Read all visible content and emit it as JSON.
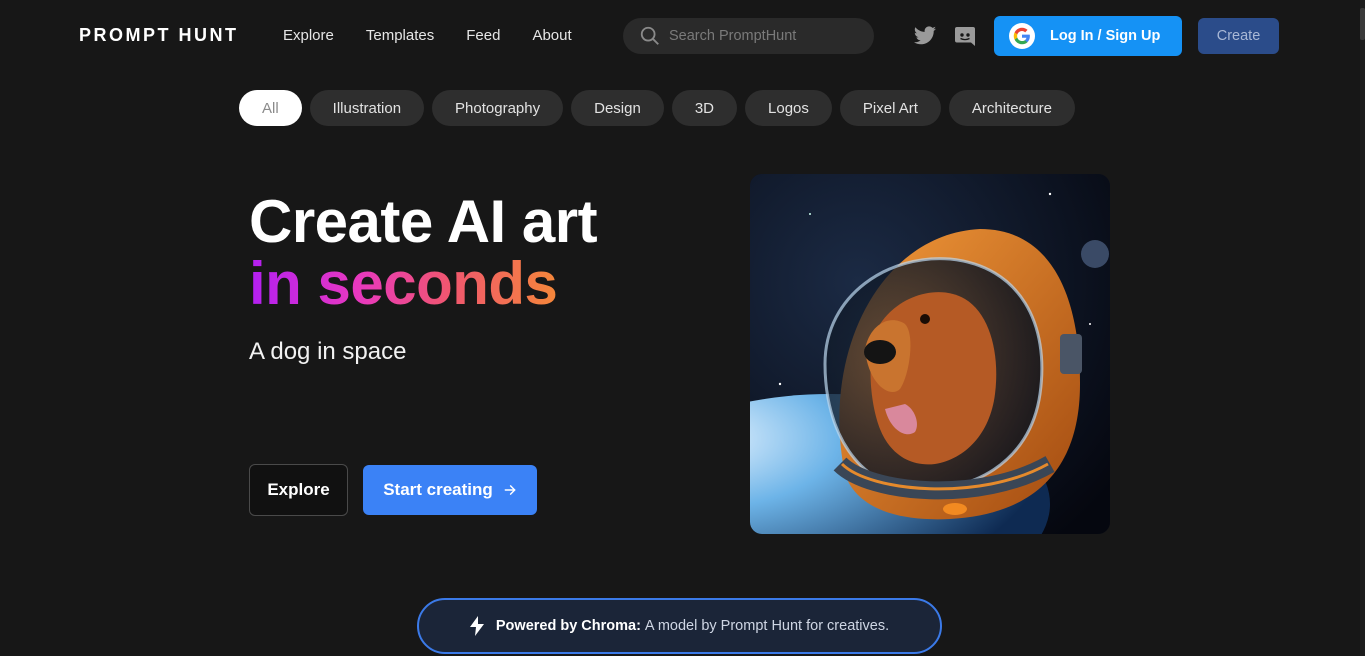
{
  "brand": {
    "logo": "PROMPT HUNT"
  },
  "nav": [
    {
      "label": "Explore",
      "name": "nav-explore"
    },
    {
      "label": "Templates",
      "name": "nav-templates"
    },
    {
      "label": "Feed",
      "name": "nav-feed"
    },
    {
      "label": "About",
      "name": "nav-about"
    }
  ],
  "search": {
    "placeholder": "Search PromptHunt",
    "value": ""
  },
  "header": {
    "login_label": "Log In / Sign Up",
    "create_label": "Create"
  },
  "categories": [
    {
      "label": "All",
      "active": true
    },
    {
      "label": "Illustration",
      "active": false
    },
    {
      "label": "Photography",
      "active": false
    },
    {
      "label": "Design",
      "active": false
    },
    {
      "label": "3D",
      "active": false
    },
    {
      "label": "Logos",
      "active": false
    },
    {
      "label": "Pixel Art",
      "active": false
    },
    {
      "label": "Architecture",
      "active": false
    }
  ],
  "hero": {
    "title_line1": "Create AI art",
    "title_line2": "in seconds",
    "subtitle": "A dog in space",
    "explore_label": "Explore",
    "start_label": "Start creating"
  },
  "powered": {
    "bold": "Powered by Chroma:",
    "text": "A model by Prompt Hunt for creatives."
  },
  "colors": {
    "background": "#171717",
    "login_blue": "#1592f5",
    "primary_blue": "#3b82f6",
    "create_button": "#2b4c8a"
  },
  "icons": [
    "search-icon",
    "twitter-icon",
    "discord-icon",
    "google-icon",
    "arrow-right-icon",
    "lightning-icon"
  ]
}
